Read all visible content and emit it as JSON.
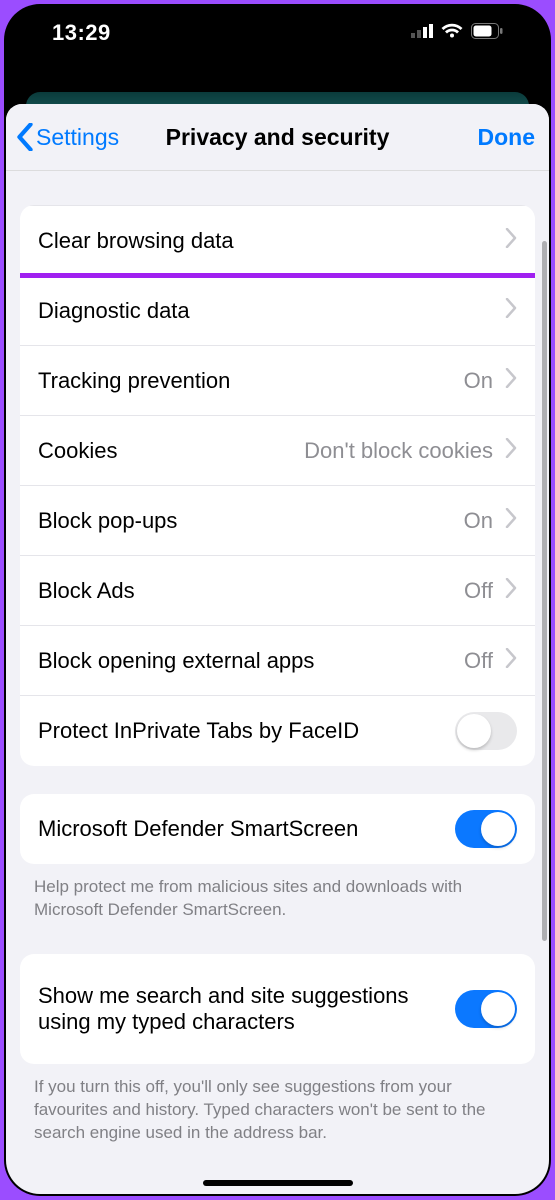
{
  "statusbar": {
    "time": "13:29"
  },
  "nav": {
    "back": "Settings",
    "title": "Privacy and security",
    "done": "Done"
  },
  "rows": {
    "clear_browsing": "Clear browsing data",
    "diagnostic": "Diagnostic data",
    "tracking": {
      "label": "Tracking prevention",
      "value": "On"
    },
    "cookies": {
      "label": "Cookies",
      "value": "Don't block cookies"
    },
    "popups": {
      "label": "Block pop-ups",
      "value": "On"
    },
    "ads": {
      "label": "Block Ads",
      "value": "Off"
    },
    "external": {
      "label": "Block opening external apps",
      "value": "Off"
    },
    "inprivate": {
      "label": "Protect InPrivate Tabs by FaceID",
      "enabled": false
    }
  },
  "smartscreen": {
    "label": "Microsoft Defender SmartScreen",
    "enabled": true,
    "footer": "Help protect me from malicious sites and downloads with Microsoft Defender SmartScreen."
  },
  "suggestions": {
    "label": "Show me search and site suggestions using my typed characters",
    "enabled": true,
    "footer": "If you turn this off, you'll only see suggestions from your favourites and history. Typed characters won't be sent to the search engine used in the address bar."
  }
}
